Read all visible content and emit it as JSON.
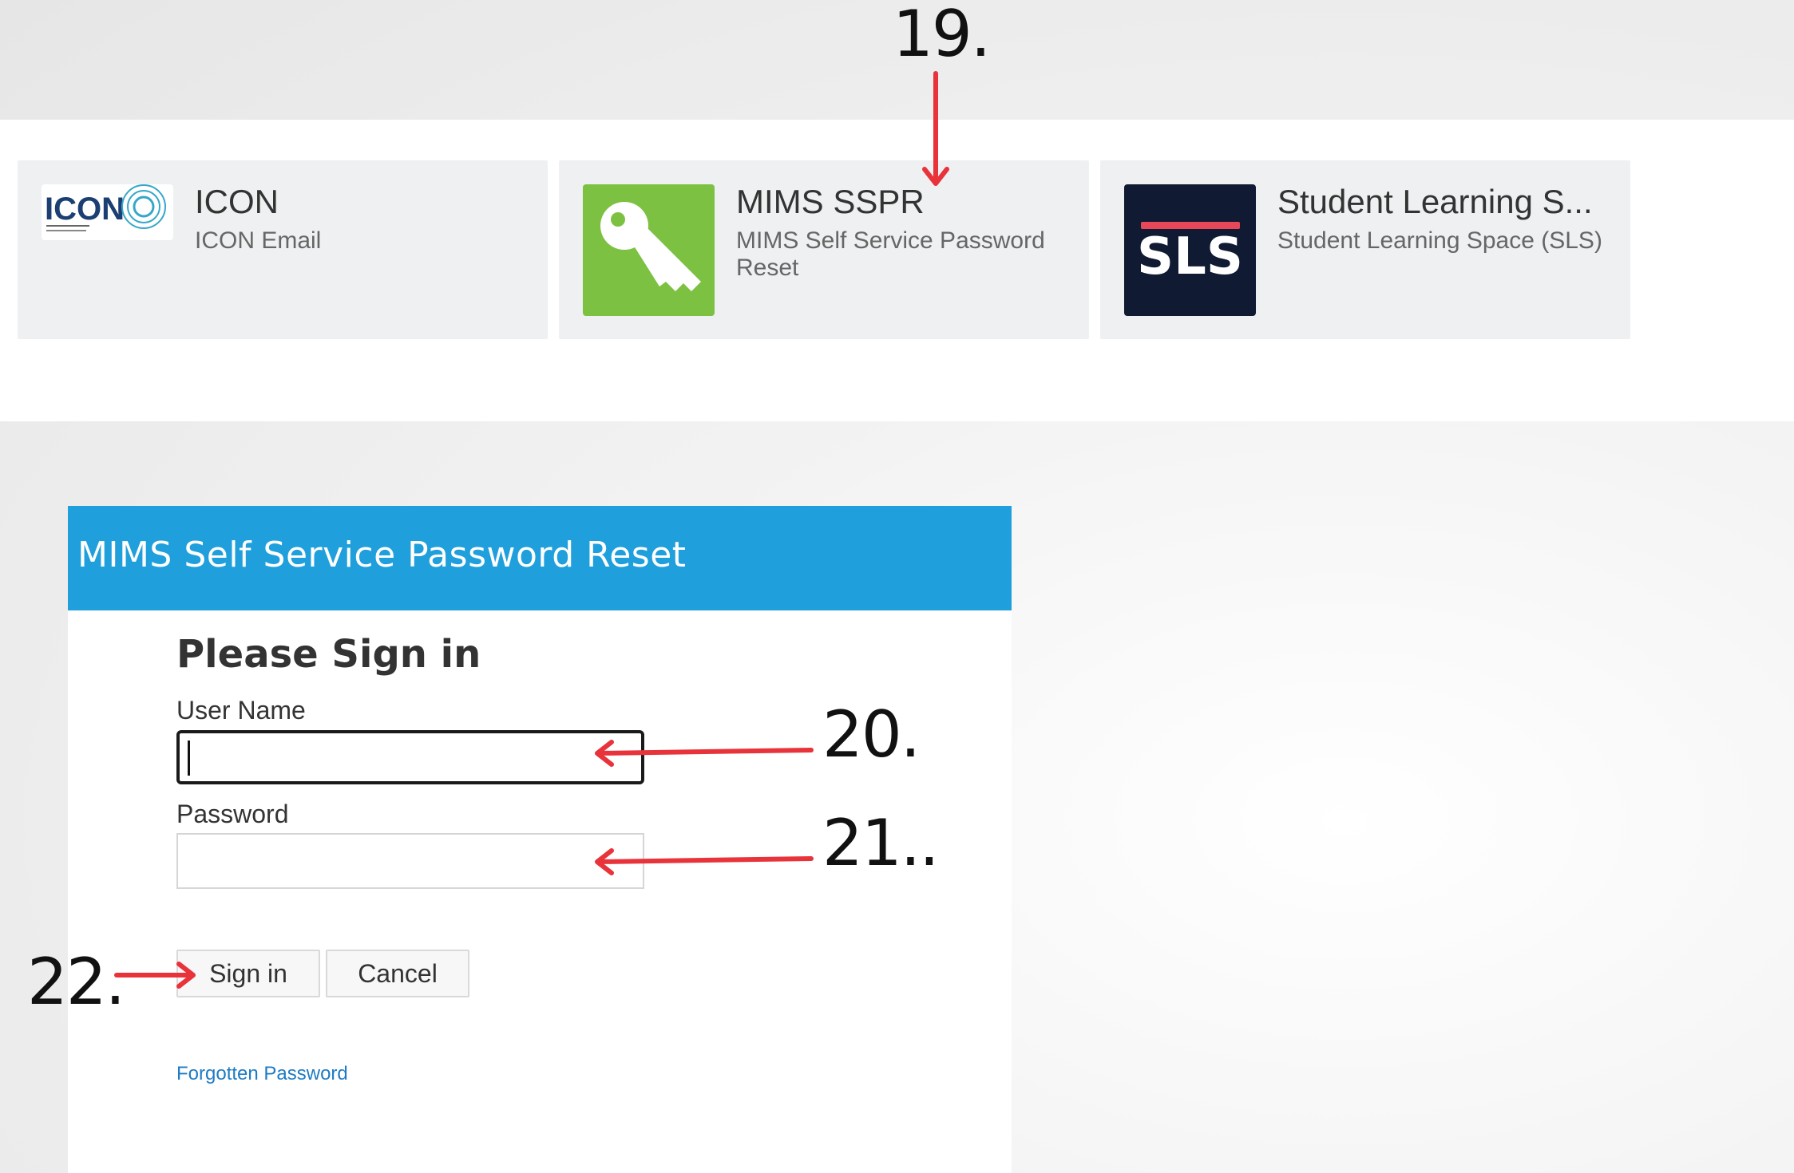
{
  "annotations": {
    "step19": "19.",
    "step20": "20.",
    "step21": "21..",
    "step22": "22."
  },
  "tiles": [
    {
      "title": "ICON",
      "subtitle": "ICON Email",
      "logo_text": "ICON"
    },
    {
      "title": "MIMS SSPR",
      "subtitle": "MIMS Self Service Password Reset",
      "icon": "key-icon"
    },
    {
      "title": "Student Learning S...",
      "subtitle": "Student Learning Space (SLS)",
      "logo_text": "SLS"
    }
  ],
  "signin": {
    "header_title": "MIMS Self Service Password Reset",
    "heading": "Please Sign in",
    "username_label": "User Name",
    "username_value": "",
    "password_label": "Password",
    "password_value": "",
    "signin_button": "Sign in",
    "cancel_button": "Cancel",
    "forgot_link": "Forgotten Password"
  },
  "colors": {
    "header_blue": "#1f9fdc",
    "key_green": "#7dc142",
    "sls_navy": "#101a33",
    "sls_red": "#e8475a",
    "arrow_red": "#e8333a"
  }
}
